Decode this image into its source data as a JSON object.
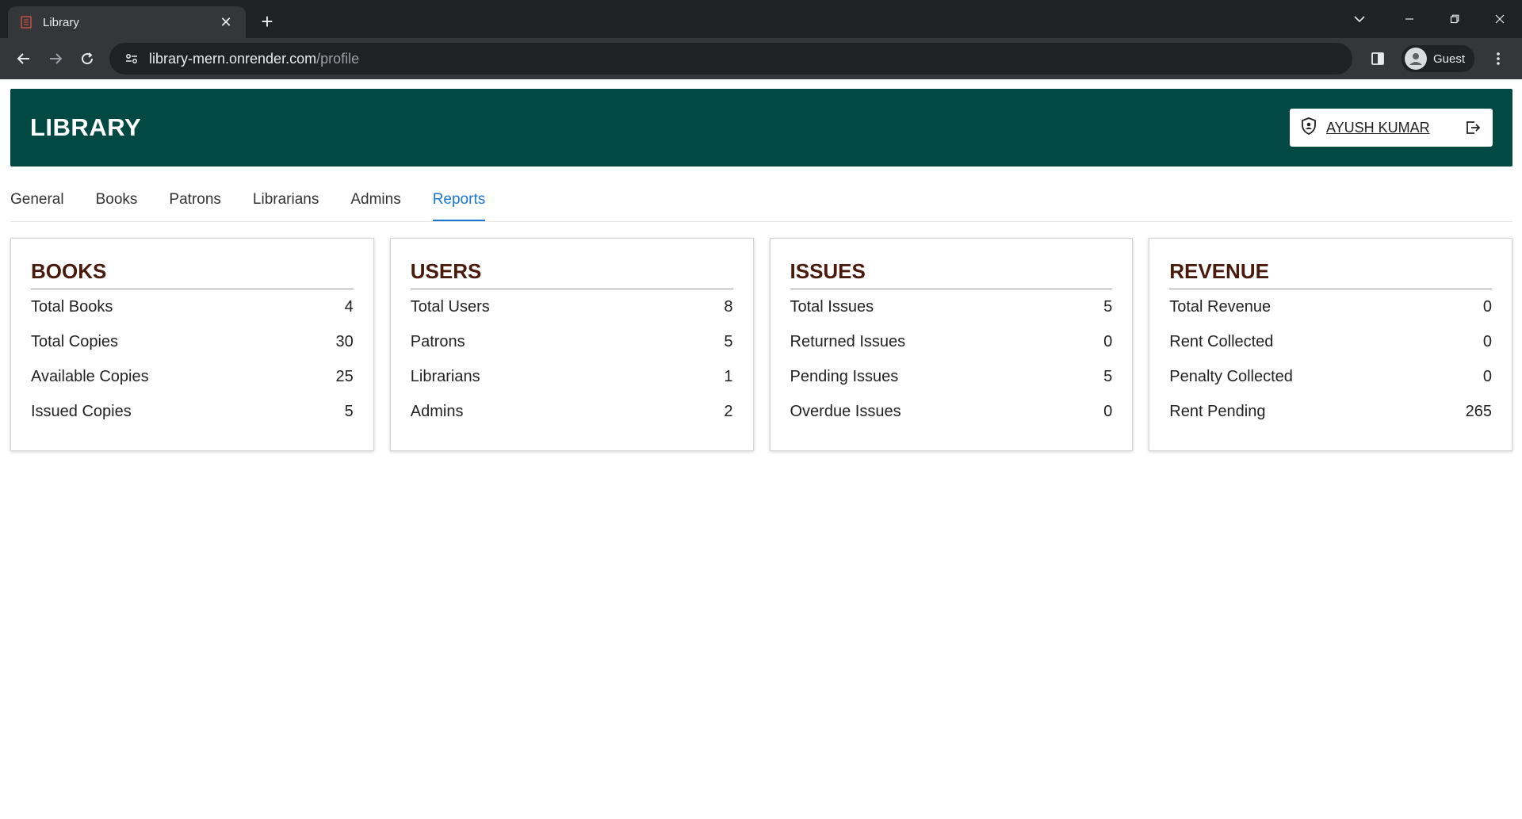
{
  "browser": {
    "tab_title": "Library",
    "url_host": "library-mern.onrender.com",
    "url_path": "/profile",
    "profile_label": "Guest"
  },
  "header": {
    "title": "LIBRARY",
    "user_name": "AYUSH KUMAR"
  },
  "tabs": [
    {
      "label": "General",
      "active": false
    },
    {
      "label": "Books",
      "active": false
    },
    {
      "label": "Patrons",
      "active": false
    },
    {
      "label": "Librarians",
      "active": false
    },
    {
      "label": "Admins",
      "active": false
    },
    {
      "label": "Reports",
      "active": true
    }
  ],
  "cards": [
    {
      "title": "BOOKS",
      "rows": [
        {
          "label": "Total Books",
          "value": "4"
        },
        {
          "label": "Total Copies",
          "value": "30"
        },
        {
          "label": "Available Copies",
          "value": "25"
        },
        {
          "label": "Issued Copies",
          "value": "5"
        }
      ]
    },
    {
      "title": "USERS",
      "rows": [
        {
          "label": "Total Users",
          "value": "8"
        },
        {
          "label": "Patrons",
          "value": "5"
        },
        {
          "label": "Librarians",
          "value": "1"
        },
        {
          "label": "Admins",
          "value": "2"
        }
      ]
    },
    {
      "title": "ISSUES",
      "rows": [
        {
          "label": "Total Issues",
          "value": "5"
        },
        {
          "label": "Returned Issues",
          "value": "0"
        },
        {
          "label": "Pending Issues",
          "value": "5"
        },
        {
          "label": "Overdue Issues",
          "value": "0"
        }
      ]
    },
    {
      "title": "REVENUE",
      "rows": [
        {
          "label": "Total Revenue",
          "value": "0"
        },
        {
          "label": "Rent Collected",
          "value": "0"
        },
        {
          "label": "Penalty Collected",
          "value": "0"
        },
        {
          "label": "Rent Pending",
          "value": "265"
        }
      ]
    }
  ],
  "colors": {
    "header_bg": "#024843",
    "card_title": "#4a1a0c",
    "active_tab": "#1976d2"
  },
  "icons": {
    "tab_favicon": "book-icon",
    "user_badge": "shield-user-icon",
    "logout": "logout-icon"
  }
}
